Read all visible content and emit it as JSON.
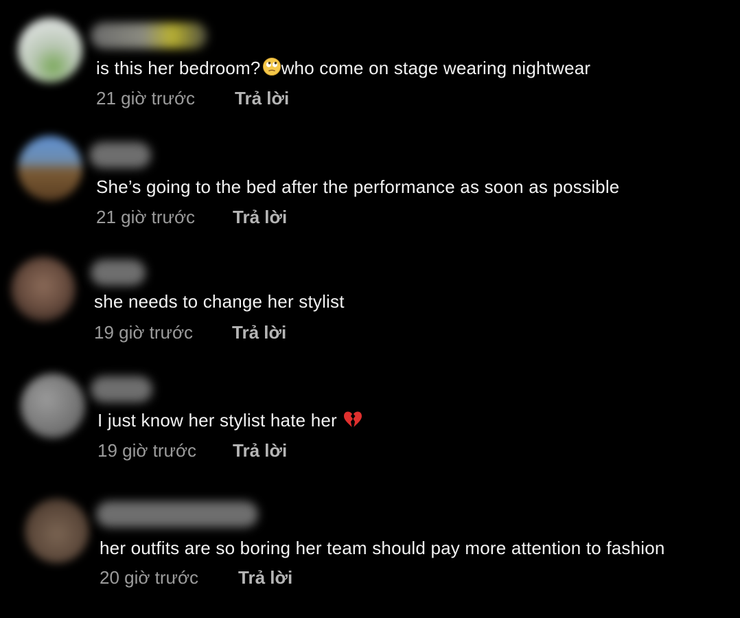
{
  "comments": [
    {
      "text": "is this her bedroom?",
      "text_suffix": "who come on stage wearing nightwear",
      "emoji": "face-with-rolling-eyes-icon",
      "time": "21 giờ trước",
      "reply": "Trả lời"
    },
    {
      "text": "She’s going to the bed after the performance as soon as possible",
      "time": "21 giờ trước",
      "reply": "Trả lời"
    },
    {
      "text": "she needs to change her stylist",
      "time": "19 giờ trước",
      "reply": "Trả lời"
    },
    {
      "text": "I just know her stylist hate her",
      "emoji": "broken-heart-icon",
      "time": "19 giờ trước",
      "reply": "Trả lời"
    },
    {
      "text": "her outfits are so boring her team should pay more attention to fashion",
      "time": "20 giờ trước",
      "reply": "Trả lời"
    }
  ]
}
